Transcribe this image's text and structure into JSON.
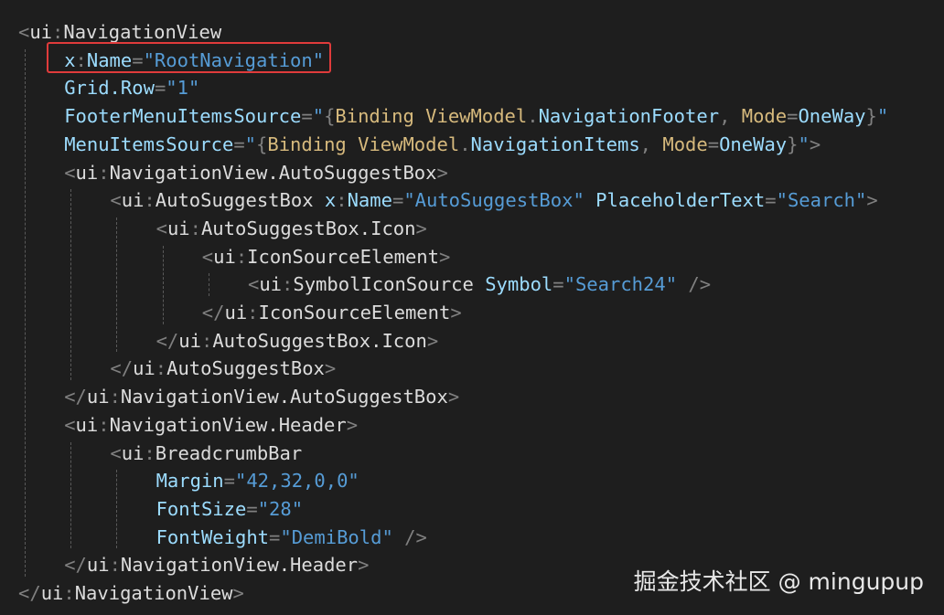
{
  "editor": {
    "theme": "dark",
    "colors": {
      "background": "#1e1e1e",
      "element": "#dcdcdc",
      "attribute": "#9cdcfe",
      "value": "#569cd6",
      "punctuation": "#808080",
      "markup_extension": "#d7ba7d",
      "highlight": "#e03b3b"
    },
    "lines": [
      [
        [
          "punct",
          "<"
        ],
        [
          "tag",
          "ui"
        ],
        [
          "punct",
          ":"
        ],
        [
          "tag",
          "NavigationView"
        ]
      ],
      [
        [
          "attr",
          "x"
        ],
        [
          "punct",
          ":"
        ],
        [
          "attr",
          "Name"
        ],
        [
          "punct",
          "="
        ],
        [
          "val",
          "\"RootNavigation\""
        ]
      ],
      [
        [
          "attr",
          "Grid.Row"
        ],
        [
          "punct",
          "="
        ],
        [
          "val",
          "\"1\""
        ]
      ],
      [
        [
          "attr",
          "FooterMenuItemsSource"
        ],
        [
          "punct",
          "="
        ],
        [
          "val",
          "\""
        ],
        [
          "punct",
          "{"
        ],
        [
          "ext",
          "Binding ViewModel"
        ],
        [
          "punct",
          "."
        ],
        [
          "attr",
          "NavigationFooter"
        ],
        [
          "punct",
          ", "
        ],
        [
          "ext",
          "Mode"
        ],
        [
          "punct",
          "="
        ],
        [
          "attr",
          "OneWay"
        ],
        [
          "punct",
          "}"
        ],
        [
          "val",
          "\""
        ]
      ],
      [
        [
          "attr",
          "MenuItemsSource"
        ],
        [
          "punct",
          "="
        ],
        [
          "val",
          "\""
        ],
        [
          "punct",
          "{"
        ],
        [
          "ext",
          "Binding ViewModel"
        ],
        [
          "punct",
          "."
        ],
        [
          "attr",
          "NavigationItems"
        ],
        [
          "punct",
          ", "
        ],
        [
          "ext",
          "Mode"
        ],
        [
          "punct",
          "="
        ],
        [
          "attr",
          "OneWay"
        ],
        [
          "punct",
          "}"
        ],
        [
          "val",
          "\""
        ],
        [
          "punct",
          ">"
        ]
      ],
      [
        [
          "punct",
          "<"
        ],
        [
          "tag",
          "ui"
        ],
        [
          "punct",
          ":"
        ],
        [
          "tag",
          "NavigationView.AutoSuggestBox"
        ],
        [
          "punct",
          ">"
        ]
      ],
      [
        [
          "punct",
          "<"
        ],
        [
          "tag",
          "ui"
        ],
        [
          "punct",
          ":"
        ],
        [
          "tag",
          "AutoSuggestBox "
        ],
        [
          "attr",
          "x"
        ],
        [
          "punct",
          ":"
        ],
        [
          "attr",
          "Name"
        ],
        [
          "punct",
          "="
        ],
        [
          "val",
          "\"AutoSuggestBox\" "
        ],
        [
          "attr",
          "PlaceholderText"
        ],
        [
          "punct",
          "="
        ],
        [
          "val",
          "\"Search\""
        ],
        [
          "punct",
          ">"
        ]
      ],
      [
        [
          "punct",
          "<"
        ],
        [
          "tag",
          "ui"
        ],
        [
          "punct",
          ":"
        ],
        [
          "tag",
          "AutoSuggestBox.Icon"
        ],
        [
          "punct",
          ">"
        ]
      ],
      [
        [
          "punct",
          "<"
        ],
        [
          "tag",
          "ui"
        ],
        [
          "punct",
          ":"
        ],
        [
          "tag",
          "IconSourceElement"
        ],
        [
          "punct",
          ">"
        ]
      ],
      [
        [
          "punct",
          "<"
        ],
        [
          "tag",
          "ui"
        ],
        [
          "punct",
          ":"
        ],
        [
          "tag",
          "SymbolIconSource "
        ],
        [
          "attr",
          "Symbol"
        ],
        [
          "punct",
          "="
        ],
        [
          "val",
          "\"Search24\" "
        ],
        [
          "punct",
          "/>"
        ]
      ],
      [
        [
          "punct",
          "</"
        ],
        [
          "tag",
          "ui"
        ],
        [
          "punct",
          ":"
        ],
        [
          "tag",
          "IconSourceElement"
        ],
        [
          "punct",
          ">"
        ]
      ],
      [
        [
          "punct",
          "</"
        ],
        [
          "tag",
          "ui"
        ],
        [
          "punct",
          ":"
        ],
        [
          "tag",
          "AutoSuggestBox.Icon"
        ],
        [
          "punct",
          ">"
        ]
      ],
      [
        [
          "punct",
          "</"
        ],
        [
          "tag",
          "ui"
        ],
        [
          "punct",
          ":"
        ],
        [
          "tag",
          "AutoSuggestBox"
        ],
        [
          "punct",
          ">"
        ]
      ],
      [
        [
          "punct",
          "</"
        ],
        [
          "tag",
          "ui"
        ],
        [
          "punct",
          ":"
        ],
        [
          "tag",
          "NavigationView.AutoSuggestBox"
        ],
        [
          "punct",
          ">"
        ]
      ],
      [
        [
          "punct",
          "<"
        ],
        [
          "tag",
          "ui"
        ],
        [
          "punct",
          ":"
        ],
        [
          "tag",
          "NavigationView.Header"
        ],
        [
          "punct",
          ">"
        ]
      ],
      [
        [
          "punct",
          "<"
        ],
        [
          "tag",
          "ui"
        ],
        [
          "punct",
          ":"
        ],
        [
          "tag",
          "BreadcrumbBar"
        ]
      ],
      [
        [
          "attr",
          "Margin"
        ],
        [
          "punct",
          "="
        ],
        [
          "val",
          "\"42,32,0,0\""
        ]
      ],
      [
        [
          "attr",
          "FontSize"
        ],
        [
          "punct",
          "="
        ],
        [
          "val",
          "\"28\""
        ]
      ],
      [
        [
          "attr",
          "FontWeight"
        ],
        [
          "punct",
          "="
        ],
        [
          "val",
          "\"DemiBold\" "
        ],
        [
          "punct",
          "/>"
        ]
      ],
      [
        [
          "punct",
          "</"
        ],
        [
          "tag",
          "ui"
        ],
        [
          "punct",
          ":"
        ],
        [
          "tag",
          "NavigationView.Header"
        ],
        [
          "punct",
          ">"
        ]
      ],
      [
        [
          "punct",
          "</"
        ],
        [
          "tag",
          "ui"
        ],
        [
          "punct",
          ":"
        ],
        [
          "tag",
          "NavigationView"
        ],
        [
          "punct",
          ">"
        ]
      ]
    ],
    "highlighted_line": 1
  },
  "watermark": {
    "text": "掘金技术社区 @ mingupup"
  }
}
